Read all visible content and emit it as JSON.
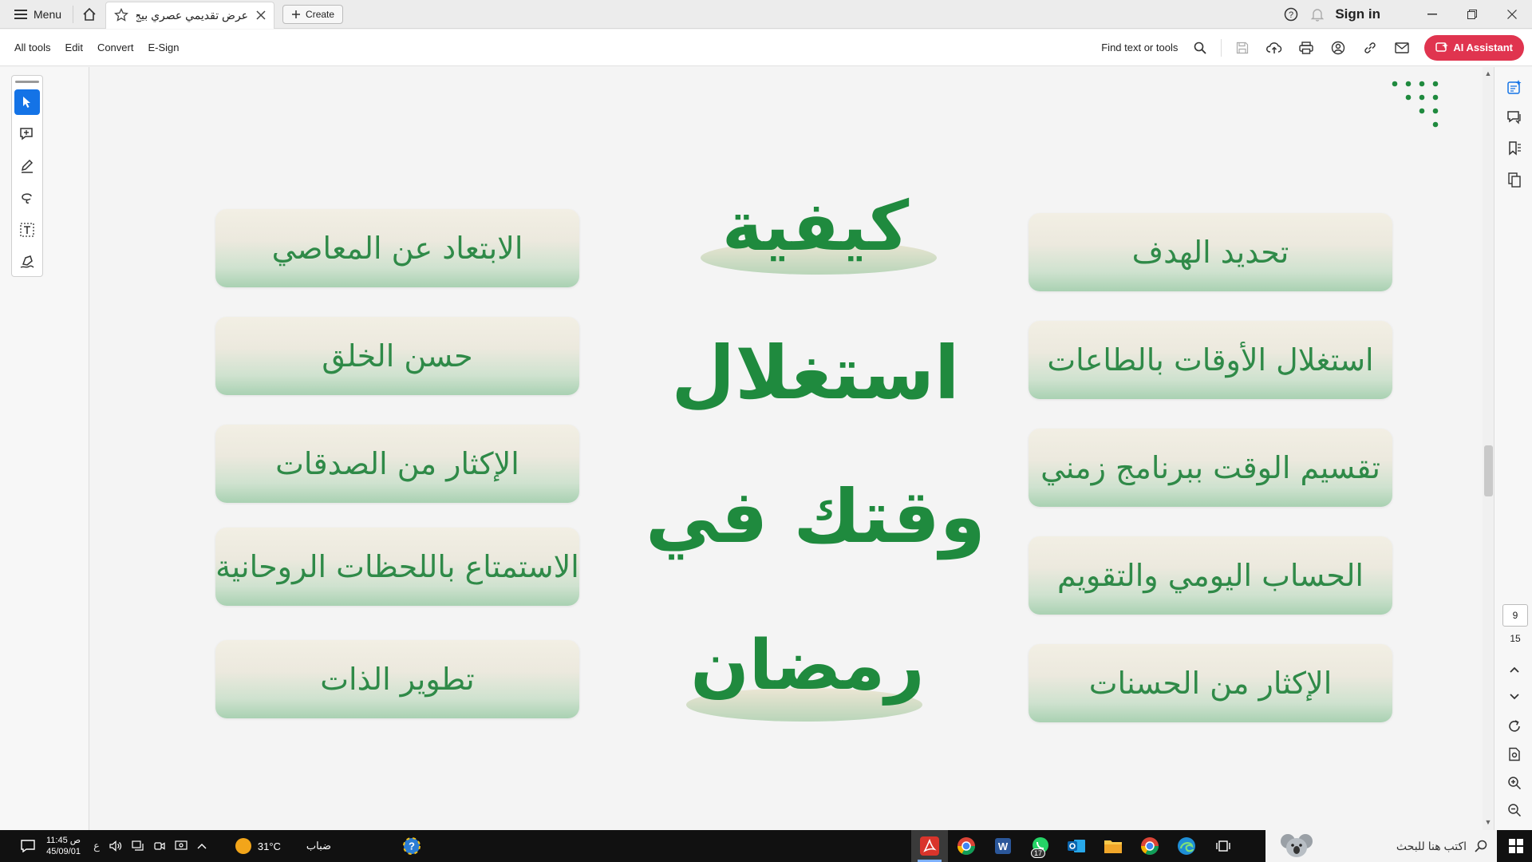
{
  "titlebar": {
    "menu_label": "Menu",
    "tab_title": "عرض تقديمي عصري بيج و ..",
    "create_label": "Create",
    "signin_label": "Sign in"
  },
  "toolbar": {
    "menu_items": [
      "All tools",
      "Edit",
      "Convert",
      "E-Sign"
    ],
    "find_label": "Find text or tools",
    "ai_label": "AI Assistant"
  },
  "slide": {
    "left_items": [
      "الابتعاد عن المعاصي",
      "حسن الخلق",
      "الإكثار من الصدقات",
      "الاستمتاع باللحظات الروحانية",
      "تطوير الذات"
    ],
    "right_items": [
      "تحديد الهدف",
      "استغلال الأوقات بالطاعات",
      "تقسيم الوقت ببرنامج زمني",
      "الحساب اليومي والتقويم",
      "الإكثار من الحسنات"
    ],
    "title_words": [
      "كيفية",
      "استغلال",
      "وقتك في",
      "رمضان"
    ],
    "accent_color": "#1f8a3e"
  },
  "page_nav": {
    "current_page": "9",
    "total_pages": "15"
  },
  "taskbar": {
    "time": "11:45 ص",
    "date": "45/09/01",
    "lang": "ع",
    "temperature": "31°C",
    "weather_text": "ضباب",
    "whatsapp_badge": "17",
    "search_placeholder": "اكتب هنا للبحث"
  }
}
